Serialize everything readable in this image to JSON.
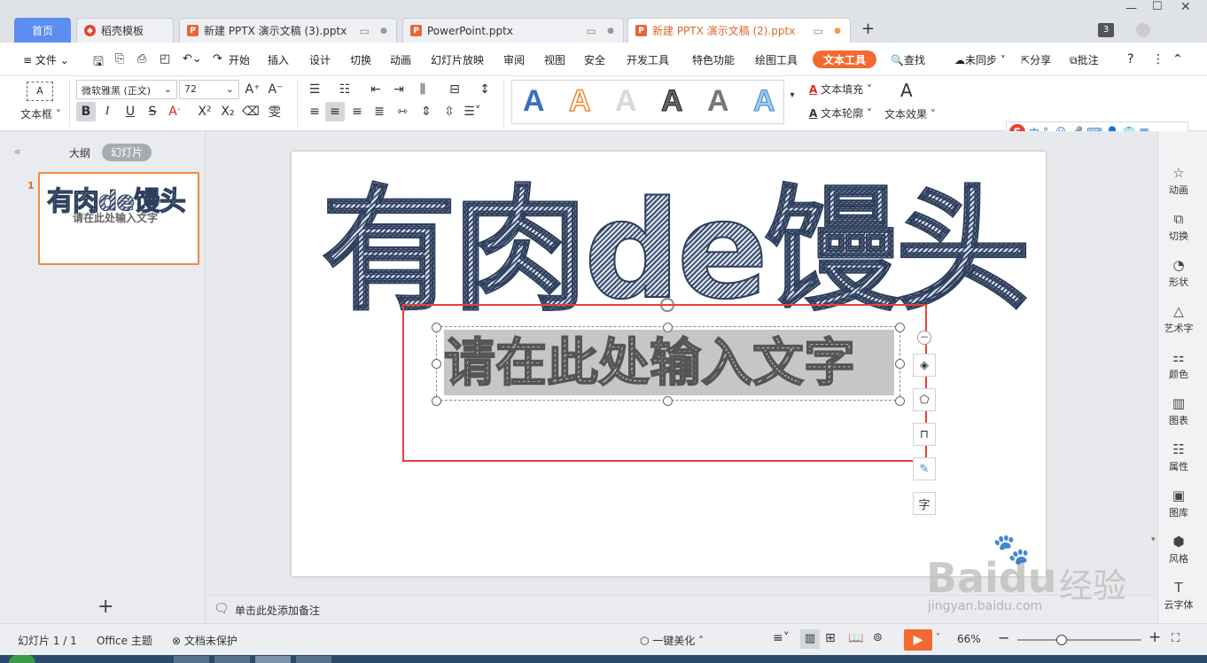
{
  "tabs": {
    "home": "首页",
    "items": [
      {
        "label": "稻壳模板"
      },
      {
        "label": "新建 PPTX 演示文稿 (3).pptx"
      },
      {
        "label": "PowerPoint.pptx"
      },
      {
        "label": "新建 PPTX 演示文稿 (2).pptx"
      }
    ],
    "badge": "3"
  },
  "menu": {
    "file": "文件",
    "items": [
      "开始",
      "插入",
      "设计",
      "切换",
      "动画",
      "幻灯片放映",
      "审阅",
      "视图",
      "安全",
      "开发工具",
      "特色功能",
      "绘图工具"
    ],
    "active": "文本工具",
    "search": "查找",
    "sync": "未同步",
    "share": "分享",
    "comment": "批注"
  },
  "ribbon": {
    "textbox": "文本框",
    "font": "微软雅黑 (正文)",
    "size": "72",
    "fill": "文本填充",
    "outline": "文本轮廓",
    "effect": "文本效果"
  },
  "ime": {
    "label": "中"
  },
  "left_panel": {
    "outline_tab": "大纲",
    "slides_tab": "幻灯片",
    "slide_number": "1",
    "thumb_title": "有肉de馒头",
    "thumb_sub": "请在此处输入文字"
  },
  "slide": {
    "title": "有肉de馒头",
    "subtitle": "请在此处输入文字"
  },
  "float_tools": {
    "text": "字"
  },
  "notes": {
    "placeholder": "单击此处添加备注"
  },
  "right_bar": [
    {
      "label": "动画",
      "icon": "star-icon"
    },
    {
      "label": "切换",
      "icon": "transition-icon"
    },
    {
      "label": "形状",
      "icon": "shapes-icon"
    },
    {
      "label": "艺术字",
      "icon": "wordart-icon"
    },
    {
      "label": "颜色",
      "icon": "palette-icon"
    },
    {
      "label": "图表",
      "icon": "chart-icon"
    },
    {
      "label": "属性",
      "icon": "properties-icon"
    },
    {
      "label": "图库",
      "icon": "gallery-icon"
    },
    {
      "label": "风格",
      "icon": "style-icon"
    },
    {
      "label": "云字体",
      "icon": "font-icon"
    }
  ],
  "status": {
    "slide_info": "幻灯片 1 / 1",
    "theme": "Office 主题",
    "protect": "文档未保护",
    "beautify": "一键美化",
    "zoom": "66%",
    "zoom_level": 0.66
  },
  "watermark": {
    "brand": "Baidu",
    "cn": "经验",
    "url": "jingyan.baidu.com"
  },
  "colors": {
    "accent": "#f26a30",
    "home_tab": "#5b8ef0",
    "highlight_box": "#e8403a"
  }
}
